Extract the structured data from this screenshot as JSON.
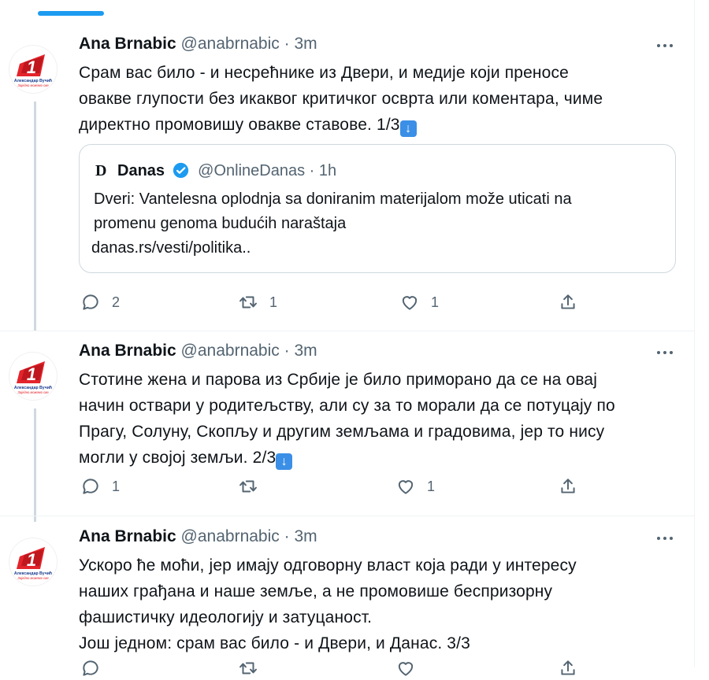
{
  "tweets": [
    {
      "name": "Ana Brnabic",
      "handle": "@anabrnabic",
      "sep": "·",
      "time": "3m",
      "lines": [
        "Срам вас било - и несрећнике из Двери, и медије који преносе",
        "овакве глупости без икаквог критичког осврта или коментара, чиме",
        "директно промовишу овакве ставове. 1/3"
      ],
      "quote": {
        "logo": "D",
        "name": "Danas",
        "handle": "@OnlineDanas",
        "sep": "·",
        "time": "1h",
        "lines": [
          "Dveri: Vantelesna oplodnja sa doniranim materijalom može uticati na",
          "promenu genoma budućih naraštaja",
          "danas.rs/vesti/politika.."
        ]
      },
      "reply_count": "2",
      "retweet_count": "1",
      "like_count": "1"
    },
    {
      "name": "Ana Brnabic",
      "handle": "@anabrnabic",
      "sep": "·",
      "time": "3m",
      "lines": [
        "Стотине жена и парова из Србије је било приморано да се на овај",
        "начин оствари у родитељству, али су за то морали да се потуцају по",
        "Прагу, Солуну, Скопљу и другим земљама и градовима, јер то нису",
        "могли у својој земљи. 2/3"
      ],
      "reply_count": "1",
      "retweet_count": "",
      "like_count": "1"
    },
    {
      "name": "Ana Brnabic",
      "handle": "@anabrnabic",
      "sep": "·",
      "time": "3m",
      "lines": [
        "Ускоро ће моћи, јер имају одговорну власт која ради у интересу",
        "наших грађана и наше земље, а не промовише беспризорну",
        "фашистичку идеологију и затуцаност.",
        "Још једном: срам вас било - и Двери, и Данас. 3/3"
      ]
    }
  ],
  "avatar": {
    "badge": "1",
    "caption1": "Александар Вучић",
    "caption2": "Заједно можемо све"
  },
  "icons": {
    "emoji_arrow": "down-arrow-emoji",
    "reply": "reply-icon",
    "retweet": "retweet-icon",
    "like": "heart-icon",
    "share": "share-icon"
  },
  "colors": {
    "accent": "#1d9bf0",
    "muted": "#536471",
    "avatar_red": "#e3242b"
  }
}
